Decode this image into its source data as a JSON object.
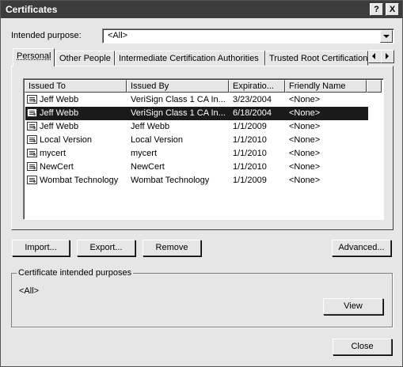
{
  "window": {
    "title": "Certificates"
  },
  "titlebar": {
    "help": "?",
    "close": "X"
  },
  "purpose": {
    "label": "Intended purpose:",
    "value": "<All>"
  },
  "tabs": [
    {
      "label": "Personal"
    },
    {
      "label": "Other People"
    },
    {
      "label": "Intermediate Certification Authorities"
    },
    {
      "label": "Trusted Root Certification"
    }
  ],
  "columns": [
    "Issued To",
    "Issued By",
    "Expiratio...",
    "Friendly Name"
  ],
  "rows": [
    {
      "issued_to": "Jeff Webb",
      "issued_by": "VeriSign Class 1 CA In...",
      "expiration": "3/23/2004",
      "friendly": "<None>",
      "selected": false
    },
    {
      "issued_to": "Jeff Webb",
      "issued_by": "VeriSign Class 1 CA In...",
      "expiration": "6/18/2004",
      "friendly": "<None>",
      "selected": true
    },
    {
      "issued_to": "Jeff Webb",
      "issued_by": "Jeff Webb",
      "expiration": "1/1/2009",
      "friendly": "<None>",
      "selected": false
    },
    {
      "issued_to": "Local Version",
      "issued_by": "Local Version",
      "expiration": "1/1/2010",
      "friendly": "<None>",
      "selected": false
    },
    {
      "issued_to": "mycert",
      "issued_by": "mycert",
      "expiration": "1/1/2010",
      "friendly": "<None>",
      "selected": false
    },
    {
      "issued_to": "NewCert",
      "issued_by": "NewCert",
      "expiration": "1/1/2010",
      "friendly": "<None>",
      "selected": false
    },
    {
      "issued_to": "Wombat Technology",
      "issued_by": "Wombat Technology",
      "expiration": "1/1/2009",
      "friendly": "<None>",
      "selected": false
    }
  ],
  "buttons": {
    "import": "Import...",
    "export": "Export...",
    "remove": "Remove",
    "advanced": "Advanced..."
  },
  "purposes_group": {
    "legend": "Certificate intended purposes",
    "value": "<All>",
    "view": "View"
  },
  "footer": {
    "close": "Close"
  }
}
